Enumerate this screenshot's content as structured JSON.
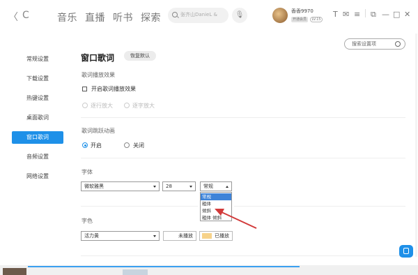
{
  "header": {
    "nav_back": "〈",
    "nav_refresh": "C",
    "tabs": [
      "音乐",
      "直播",
      "听书",
      "探索"
    ],
    "search_placeholder": "张齐山DanieL &",
    "user": {
      "name": "香香9970",
      "vip_label": "开通会员",
      "level": "LV.15"
    },
    "icons": [
      "shirt-icon",
      "mail-icon",
      "menu-icon",
      "mini-mode-icon",
      "minimize-icon",
      "maximize-icon",
      "close-icon"
    ],
    "icon_glyphs": [
      "T",
      "✉",
      "≡",
      "⧉",
      "—",
      "□",
      "✕"
    ]
  },
  "settings_search": {
    "placeholder": "搜索设置项"
  },
  "sidebar": {
    "items": [
      {
        "label": "常规设置",
        "active": false
      },
      {
        "label": "下载设置",
        "active": false
      },
      {
        "label": "热键设置",
        "active": false
      },
      {
        "label": "桌面歌词",
        "active": false
      },
      {
        "label": "窗口歌词",
        "active": true
      },
      {
        "label": "音频设置",
        "active": false
      },
      {
        "label": "网络设置",
        "active": false
      }
    ]
  },
  "main": {
    "title": "窗口歌词",
    "restore_button": "恢复默认",
    "lyric_effect": {
      "label": "歌词播放效果",
      "checkbox_label": "开启歌词播放效果",
      "checked": false,
      "options": [
        "逐行放大",
        "逐字放大"
      ]
    },
    "lyric_jump": {
      "label": "歌词跳跃动画",
      "options": [
        {
          "label": "开启",
          "selected": true
        },
        {
          "label": "关闭",
          "selected": false
        }
      ]
    },
    "font": {
      "label": "字体",
      "family": "微软雅黑",
      "size": "28",
      "style": "常规",
      "style_options": [
        "常规",
        "粗体",
        "倾斜",
        "粗体 倾斜"
      ],
      "highlighted_option": "常规"
    },
    "color": {
      "label": "字色",
      "scheme": "活力黄",
      "unplayed_label": "未播放",
      "played_label": "已播放",
      "played_color": "#f6d28a"
    }
  },
  "annotation": {
    "arrow_color": "#d23a3a"
  }
}
